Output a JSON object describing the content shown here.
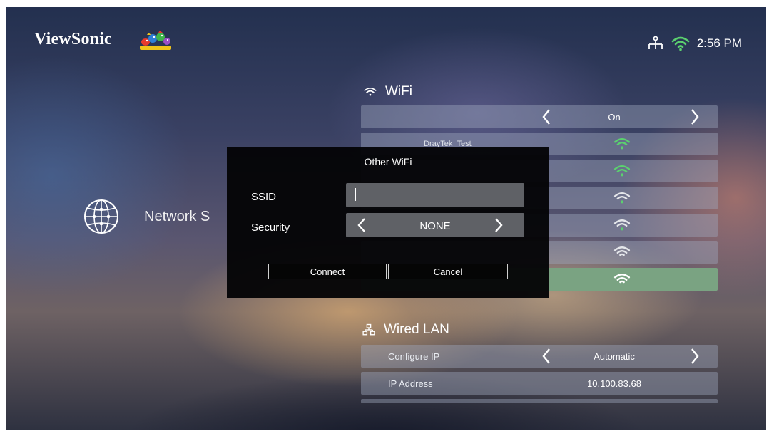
{
  "header": {
    "brand": "ViewSonic",
    "time": "2:56 PM"
  },
  "left_panel": {
    "label": "Network S"
  },
  "wifi": {
    "title": "WiFi",
    "toggle_value": "On",
    "networks": [
      {
        "name": "DrayTek_Test",
        "signal": "strong"
      },
      {
        "name": "",
        "signal": "strong"
      },
      {
        "name": "",
        "signal": "medium"
      },
      {
        "name": "",
        "signal": "medium"
      },
      {
        "name": "",
        "signal": "full"
      },
      {
        "name": "",
        "signal": "full"
      }
    ]
  },
  "wired_lan": {
    "title": "Wired LAN",
    "configure_ip_label": "Configure IP",
    "configure_ip_value": "Automatic",
    "ip_address_label": "IP Address",
    "ip_address_value": "10.100.83.68"
  },
  "dialog": {
    "title": "Other WiFi",
    "ssid_label": "SSID",
    "ssid_value": "",
    "security_label": "Security",
    "security_value": "NONE",
    "connect_label": "Connect",
    "cancel_label": "Cancel"
  },
  "colors": {
    "selected_row": "#7aa382",
    "wifi_green": "#5bd16f",
    "wifi_white": "#e4e6ea"
  }
}
